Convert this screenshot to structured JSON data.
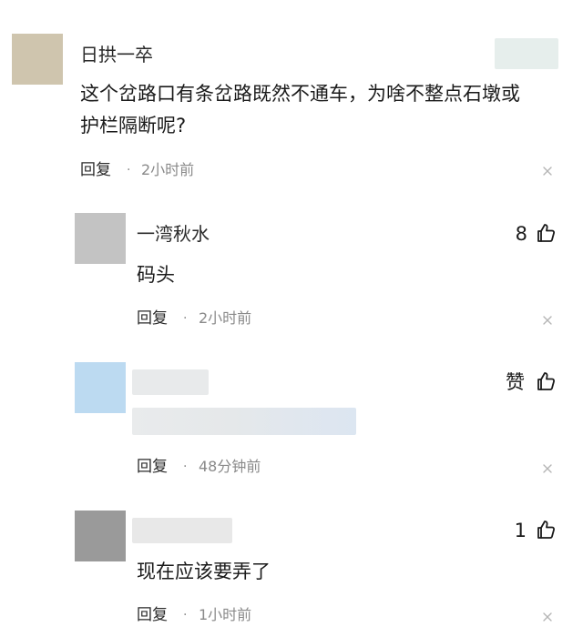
{
  "colors": {
    "avatar_top": "#cfc5ae",
    "avatar_wanqiushui": "#c3c3c3",
    "avatar_blue": "#bcdaf1",
    "avatar_gray": "#9a9a9a",
    "blur_light": "#e8eaeb",
    "blur_blue": "#dfe6f0",
    "text_secondary": "#8a8a8a"
  },
  "icons": {
    "like": "thumbs-up-icon",
    "close": "close-icon"
  },
  "main_comment": {
    "username": "日拱一卒",
    "text_line1": "这个岔路口有条岔路既然不通车，为啥不整点石墩或",
    "text_line2": "护栏隔断呢?",
    "reply_label": "回复",
    "separator": "·",
    "time": "2小时前"
  },
  "replies": [
    {
      "username": "一湾秋水",
      "text": "码头",
      "likes": "8",
      "reply_label": "回复",
      "separator": "·",
      "time": "2小时前"
    },
    {
      "username": "",
      "text": "",
      "likes": "赞",
      "reply_label": "回复",
      "separator": "·",
      "time": "48分钟前"
    },
    {
      "username": "",
      "text": "现在应该要弄了",
      "likes": "1",
      "reply_label": "回复",
      "separator": "·",
      "time": "1小时前"
    }
  ]
}
